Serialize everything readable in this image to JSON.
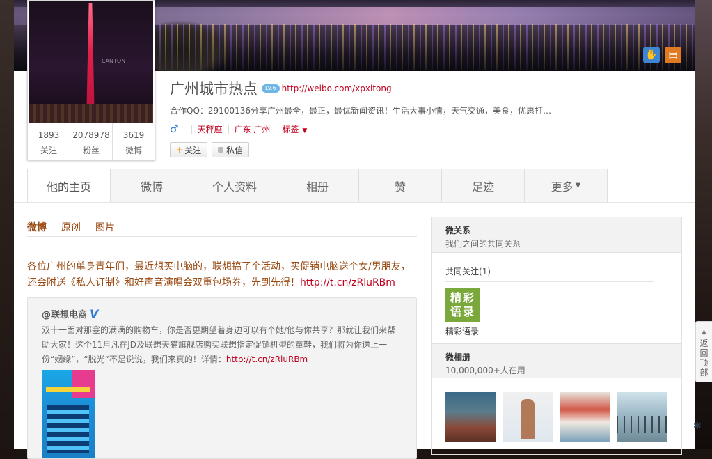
{
  "profile": {
    "name": "广州城市热点",
    "level_badge": "LV.6",
    "domain_link": "http://weibo.com/xpxitong",
    "intro": "合作QQ：29100136分享广州最全，最正，最优新闻资讯！生活大事小情，天气交通，美食，优惠打…",
    "gender_icon": "male-icon",
    "constellation": "天秤座",
    "location": "广东 广州",
    "tags_label": "标签",
    "follow_button": "关注",
    "message_button": "私信",
    "avatar_watermark": "CANTON",
    "stats": [
      {
        "num": "1893",
        "label": "关注"
      },
      {
        "num": "2078978",
        "label": "粉丝"
      },
      {
        "num": "3619",
        "label": "微博"
      }
    ]
  },
  "tabs": [
    "他的主页",
    "微博",
    "个人资料",
    "相册",
    "赞",
    "足迹",
    "更多"
  ],
  "subtabs": [
    "微博",
    "原创",
    "图片"
  ],
  "post": {
    "text": "各位广州的单身青年们，最近想买电脑的，联想搞了个活动，买促销电脑送个女/男朋友，还会附送《私人订制》和好声音演唱会双重包场券，先到先得！",
    "link": "http://t.cn/zRluRBm"
  },
  "repost": {
    "author": "@联想电商",
    "verified_mark": "V",
    "text": "双十一面对那塞的满满的购物车，你是否更期望着身边可以有个她/他与你共享？那就让我们来帮助大家！这个11月凡在JD及联想天猫旗舰店购买联想指定促销机型的童鞋，我们将为你送上一份“姻缘”，“脱光”不是说说，我们来真的！详情：",
    "link": "http://t.cn/zRluRBm"
  },
  "sidebar": {
    "relation_title": "微关系",
    "relation_sub": "我们之间的共同关系",
    "mutual_label": "共同关注",
    "mutual_count": "(1)",
    "mutual_avatar_text_line1": "精彩",
    "mutual_avatar_text_line2": "语录",
    "mutual_name": "精彩语录",
    "album_title": "微相册",
    "album_sub": "10,000,000+人在用"
  },
  "back_to_top": "返回顶部",
  "colors": {
    "link_red": "#c0001e",
    "post_brown": "#9a4b14",
    "verified_blue": "#2e7cd6",
    "follow_plus_orange": "#f08a00"
  }
}
